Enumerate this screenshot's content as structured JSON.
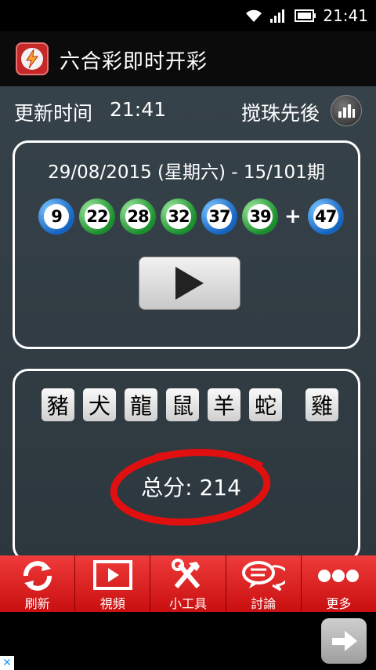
{
  "status_bar": {
    "time": "21:41"
  },
  "app": {
    "title": "六合彩即时开彩"
  },
  "info": {
    "update_label": "更新时间",
    "update_time": "21:41",
    "order_label": "搅珠先後"
  },
  "draw": {
    "title": "29/08/2015 (星期六) - 15/101期",
    "balls": [
      {
        "number": "9",
        "color": "blue"
      },
      {
        "number": "22",
        "color": "green"
      },
      {
        "number": "28",
        "color": "green"
      },
      {
        "number": "32",
        "color": "green"
      },
      {
        "number": "37",
        "color": "blue"
      },
      {
        "number": "39",
        "color": "green"
      }
    ],
    "plus": "+",
    "special_ball": {
      "number": "47",
      "color": "blue"
    }
  },
  "zodiac": {
    "items": [
      "豬",
      "犬",
      "龍",
      "鼠",
      "羊",
      "蛇"
    ],
    "special": "雞"
  },
  "score": {
    "text": "总分: 214"
  },
  "tabs": [
    {
      "label": "刷新",
      "icon": "refresh-icon"
    },
    {
      "label": "視頻",
      "icon": "video-icon"
    },
    {
      "label": "小工具",
      "icon": "tools-icon"
    },
    {
      "label": "討論",
      "icon": "chat-icon"
    },
    {
      "label": "更多",
      "icon": "more-icon"
    }
  ],
  "ad": {
    "close": "✕"
  },
  "colors": {
    "blue_ball": "#1565c0",
    "green_ball": "#1b8f2e",
    "tab_red": "#d81b1b",
    "score_circle": "#e01010"
  }
}
